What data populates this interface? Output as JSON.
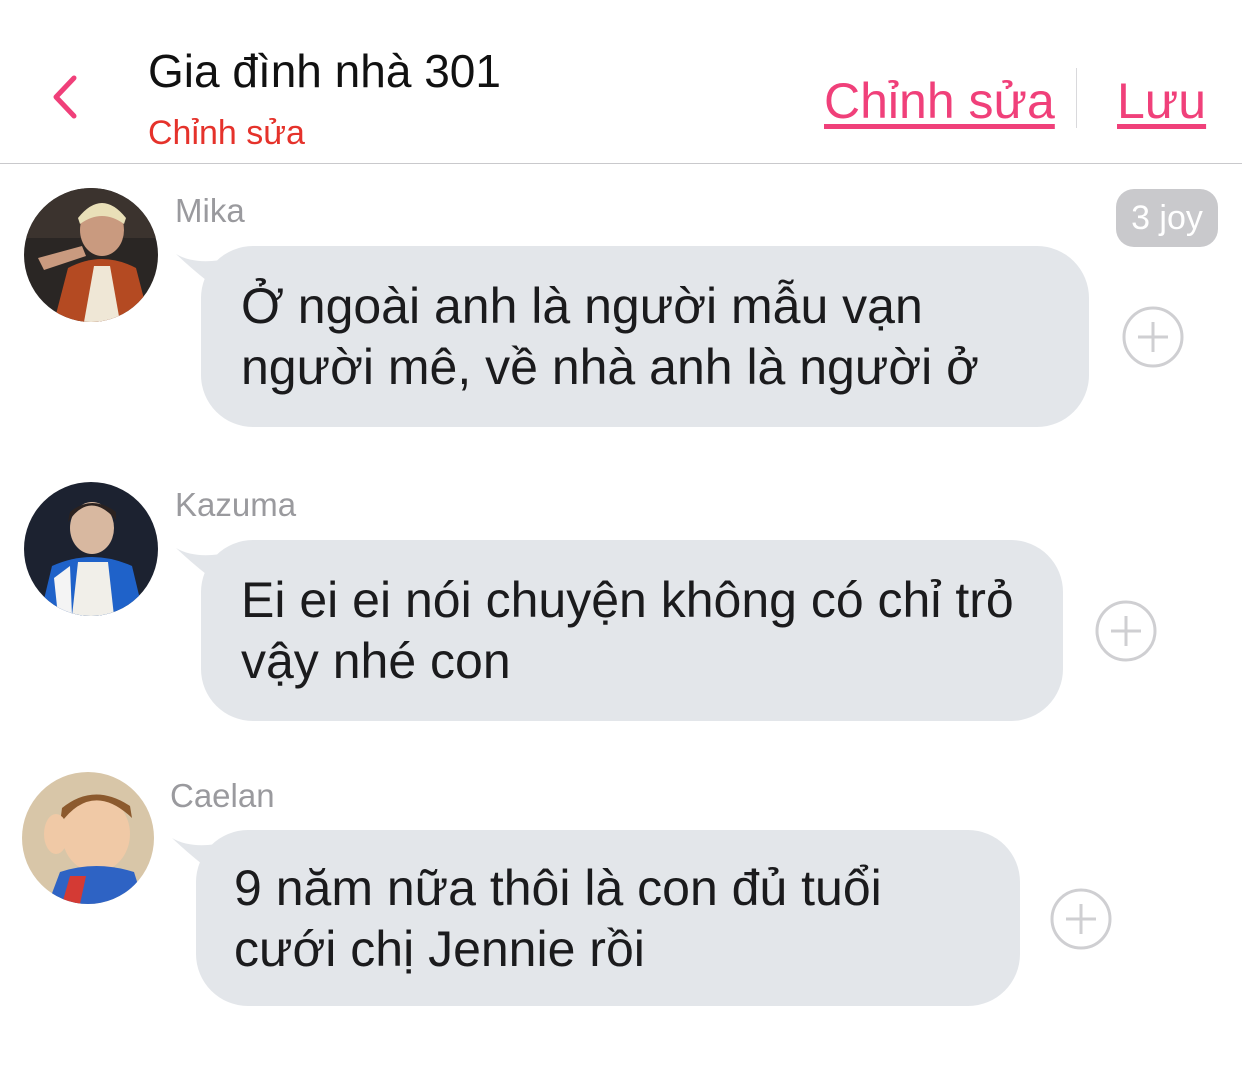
{
  "header": {
    "title": "Gia đình nhà 301",
    "subtitle": "Chỉnh sửa",
    "edit_label": "Chỉnh sửa",
    "save_label": "Lưu"
  },
  "badge": "3 joy",
  "messages": [
    {
      "sender": "Mika",
      "text": "Ở ngoài anh là người mẫu vạn người mê, về nhà anh là người ở"
    },
    {
      "sender": "Kazuma",
      "text": "Ei ei ei nói chuyện không có chỉ trỏ vậy nhé con"
    },
    {
      "sender": "Caelan",
      "text": "9 năm nữa thôi là con đủ tuổi cưới chị Jennie rồi"
    }
  ],
  "icons": {
    "back": "chevron-left-icon",
    "add_reaction": "plus-circle-icon"
  },
  "colors": {
    "accent": "#f0407a",
    "subtitle": "#e5322b",
    "bubble": "#e3e6ea",
    "sender_name": "#9a9a9e"
  }
}
